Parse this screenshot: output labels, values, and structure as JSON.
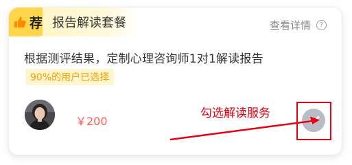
{
  "card": {
    "recommend_label": "荐",
    "package_title": "报告解读套餐",
    "detail_link": "查看详情",
    "description": "根据测评结果，定制心理咨询师1对1解读报告",
    "popularity_badge": "90%的用户已选择",
    "price": "￥200"
  },
  "annotation": {
    "text": "勾选解读服务"
  },
  "icons": {
    "recommend": "thumbs-up-icon",
    "help": "question-circle-icon",
    "select": "check-circle-icon"
  },
  "colors": {
    "recommend_badge": "#ffd64a",
    "price": "#ff5a50",
    "popularity_text": "#f5a000",
    "annotation": "#e60012",
    "check_circle": "#b9bcc6"
  }
}
